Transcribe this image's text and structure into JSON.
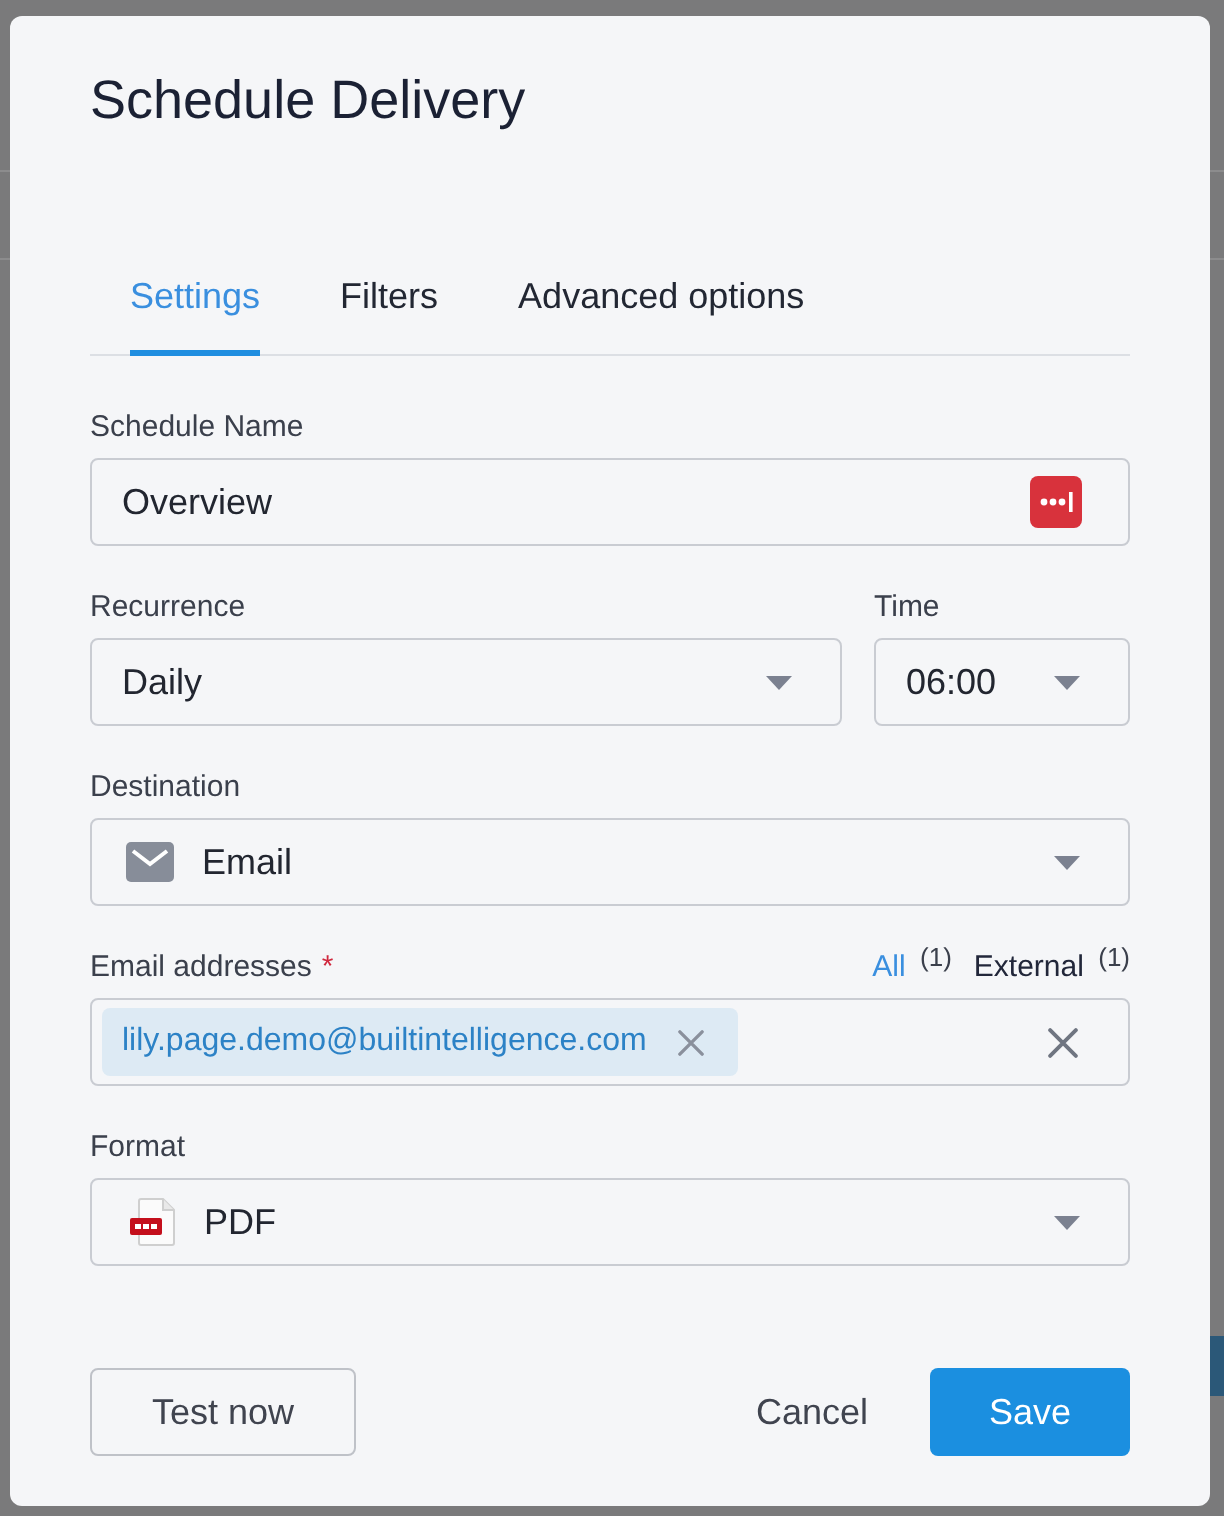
{
  "dialog": {
    "title": "Schedule Delivery"
  },
  "tabs": [
    {
      "label": "Settings",
      "selected": true
    },
    {
      "label": "Filters",
      "selected": false
    },
    {
      "label": "Advanced options",
      "selected": false
    }
  ],
  "form": {
    "rows": [
      [
        {
          "kind": "text",
          "label": "Schedule Name",
          "value": "Overview"
        }
      ],
      [
        {
          "kind": "select",
          "label": "Recurrence",
          "value": "Daily"
        },
        {
          "kind": "select",
          "label": "Time",
          "value": "06:00"
        }
      ],
      [
        {
          "kind": "destination",
          "label": "Destination",
          "value": "Email"
        }
      ],
      [
        {
          "kind": "tags",
          "label": "Email addresses",
          "required": true,
          "required_mark": "*",
          "filters": [
            {
              "label": "All $^{(1)}$",
              "selected": true
            },
            {
              "label": "External $^{(1)}$",
              "selected": false
            }
          ],
          "tags": [
            "lily.page.demo@builtintelligence.com"
          ]
        }
      ],
      [
        {
          "kind": "format",
          "label": "Format",
          "value": "PDF"
        }
      ]
    ]
  },
  "buttons": [
    {
      "label": "Test now",
      "kind": "secondary"
    },
    {
      "label": "Cancel",
      "kind": "plain"
    },
    {
      "label": "Save",
      "kind": "primary"
    }
  ]
}
